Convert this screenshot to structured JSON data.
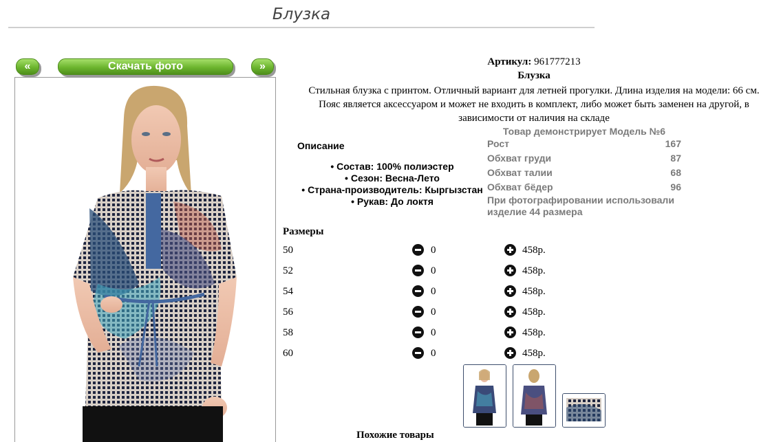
{
  "page": {
    "title": "Блузка"
  },
  "nav": {
    "prev_label": "«",
    "download_label": "Скачать фото",
    "next_label": "»"
  },
  "product": {
    "sku_label": "Артикул:",
    "sku_value": "961777213",
    "name": "Блузка",
    "description_lines": [
      "Стильная блузка с принтом. Отличный вариант для летней прогулки. Длина изделия на модели: 66 см.",
      "Пояс является аксессуаром и может не входить в комплект, либо может быть заменен на другой, в",
      "зависимости от наличия на складе"
    ]
  },
  "features": {
    "title": "Описание",
    "items": [
      "Состав: 100% полиэстер",
      "Сезон: Весна-Лето",
      "Страна-производитель: Кыргызстан",
      "Рукав: До локтя"
    ]
  },
  "model": {
    "heading": "Товар демонстрирует Модель №6",
    "rows": [
      {
        "label": "Рост",
        "value": "167"
      },
      {
        "label": "Обхват груди",
        "value": "87"
      },
      {
        "label": "Обхват талии",
        "value": "68"
      },
      {
        "label": "Обхват бёдер",
        "value": "96"
      }
    ],
    "note_lines": [
      "При фотографировании использовали",
      "изделие 44 размера"
    ]
  },
  "sizes": {
    "title": "Размеры",
    "rows": [
      {
        "size": "50",
        "qty": "0",
        "price": "458р."
      },
      {
        "size": "52",
        "qty": "0",
        "price": "458р."
      },
      {
        "size": "54",
        "qty": "0",
        "price": "458р."
      },
      {
        "size": "56",
        "qty": "0",
        "price": "458р."
      },
      {
        "size": "58",
        "qty": "0",
        "price": "458р."
      },
      {
        "size": "60",
        "qty": "0",
        "price": "458р."
      }
    ]
  },
  "similar": {
    "title": "Похожие товары"
  },
  "colors": {
    "button_green": "#6cb52e",
    "thumb_border": "#3c4d6b",
    "muted_text": "#7a7a7a"
  }
}
